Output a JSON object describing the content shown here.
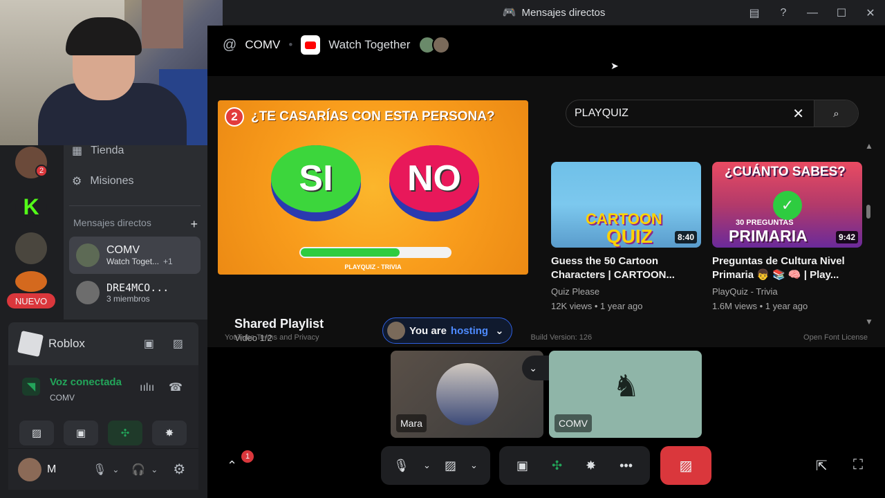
{
  "window": {
    "title": "Mensajes directos"
  },
  "channel_header": {
    "name": "COMV",
    "activity": "Watch Together"
  },
  "sidebar": {
    "items": [
      {
        "label": "Tienda"
      },
      {
        "label": "Misiones"
      }
    ],
    "dm_header": "Mensajes directos",
    "dms": [
      {
        "name": "COMV",
        "sub": "Watch Toget...",
        "extra": "+1"
      },
      {
        "name": "DRE4MCO...",
        "sub": "3 miembros"
      }
    ],
    "new_badge": "NUEVO",
    "notif_count": "2"
  },
  "roblox": {
    "label": "Roblox"
  },
  "voice": {
    "status": "Voz conectada",
    "channel": "COMV"
  },
  "user": {
    "name": "M"
  },
  "player": {
    "thumb_number": "2",
    "thumb_question": "¿TE CASARÍAS CON ESTA PERSONA?",
    "thumb_yes": "SI",
    "thumb_no": "NO",
    "thumb_brand": "PLAYQUIZ - TRIVIA",
    "progress": 0.66,
    "playlist_title": "Shared Playlist",
    "playlist_sub": "Video 1/2",
    "hosting_prefix": "You are",
    "hosting_word": "hosting"
  },
  "search": {
    "value": "PLAYQUIZ"
  },
  "videos": [
    {
      "thumb_text_1": "CARTOON",
      "thumb_text_2": "QUIZ",
      "duration": "8:40",
      "title": "Guess the 50 Cartoon Characters | CARTOON...",
      "channel": "Quiz Please",
      "meta": "12K views • 1 year ago"
    },
    {
      "thumb_text_1": "¿CUÁNTO SABES?",
      "thumb_text_2": "30 PREGUNTAS",
      "thumb_text_3": "PRIMARIA",
      "duration": "9:42",
      "title": "Preguntas de Cultura Nivel Primaria 👦 📚 🧠 | Play...",
      "channel": "PlayQuiz - Trivia",
      "meta": "1.6M views • 1 year ago"
    }
  ],
  "footer": {
    "left": "YouTube Terms and Privacy",
    "center": "Build Version: 126",
    "right": "Open Font License"
  },
  "tiles": [
    {
      "label": "Mara"
    },
    {
      "label": "COMV"
    }
  ],
  "controls": {
    "notif_count": "1"
  },
  "colors": {
    "accent": "#5865f2",
    "danger": "#da373c",
    "online": "#23a55a",
    "youtube": "#ff0000"
  }
}
